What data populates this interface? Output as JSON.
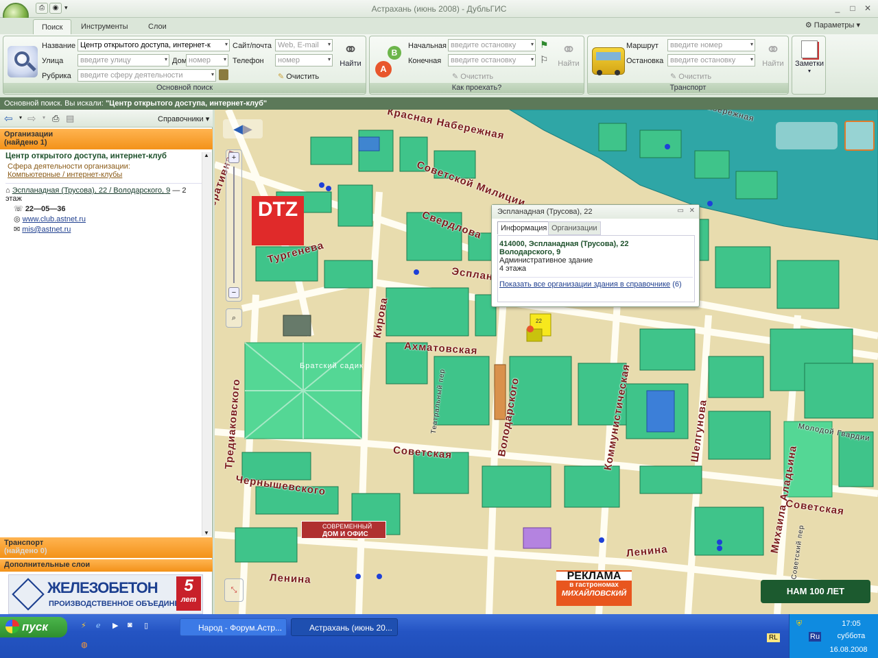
{
  "window": {
    "title": "Астрахань (июнь 2008) - ДубльГИС"
  },
  "tabs": [
    "Поиск",
    "Инструменты",
    "Слои"
  ],
  "params_label": "Параметры",
  "search": {
    "name_label": "Название",
    "name_value": "Центр открытого доступа, интернет-к",
    "street_label": "Улица",
    "street_placeholder": "введите улицу",
    "house_label": "Дом",
    "house_placeholder": "номер",
    "rubric_label": "Рубрика",
    "rubric_placeholder": "введите сферу деятельности",
    "site_label": "Сайт/почта",
    "site_placeholder": "Web, E-mail",
    "phone_label": "Телефон",
    "phone_placeholder": "номер",
    "find_label": "Найти",
    "clear_label": "Очистить",
    "group_title": "Основной поиск"
  },
  "route": {
    "start_label": "Начальная",
    "end_label": "Конечная",
    "placeholder": "введите остановку",
    "find_label": "Найти",
    "clear_label": "Очистить",
    "group_title": "Как проехать?"
  },
  "transport": {
    "route_label": "Маршрут",
    "route_placeholder": "введите номер",
    "stop_label": "Остановка",
    "stop_placeholder": "введите остановку",
    "find_label": "Найти",
    "clear_label": "Очистить",
    "group_title": "Транспорт"
  },
  "notes_label": "Заметки",
  "infobar": {
    "prefix": "Основной поиск. Вы искали:",
    "query": "\"Центр открытого доступа, интернет-клуб\""
  },
  "sidebar": {
    "directories": "Справочники",
    "orgs_header": "Организации",
    "orgs_found": "(найдено 1)",
    "org_name": "Центр открытого доступа, интернет-клуб",
    "sphere_label": "Сфера деятельности организации:",
    "sphere_link": "Компьютерные / интернет-клубы",
    "address_link": "Эспланадная (Трусова), 22 / Володарского, 9",
    "address_suffix": "— 2",
    "floor": "этаж",
    "phone": "22—05—36",
    "site": "www.club.astnet.ru",
    "email": "mis@astnet.ru",
    "transport_header": "Транспорт",
    "transport_found": "(найдено 0)",
    "layers_header": "Дополнительные слои",
    "ad_title": "ЖЕЛЕЗОБЕТОН",
    "ad_sub": "ПРОИЗВОДСТВЕННОЕ ОБЪЕДИНЕНИЕ",
    "ad_years": "5",
    "ad_years_word": "лет"
  },
  "popup": {
    "title": "Эспланадная (Трусова), 22",
    "tab_info": "Информация",
    "tab_orgs": "Организации",
    "addr1": "414000, Эспланадная (Трусова), 22",
    "addr2": "Володарского, 9",
    "type": "Административное здание",
    "floors": "4 этажа",
    "link": "Показать все организации здания в справочнике",
    "count": "(6)"
  },
  "map": {
    "streets": [
      "Красная Набережная",
      "Советской Милиции",
      "Свердлова",
      "Тургенева",
      "Эспланадная",
      "Кирова",
      "Ахматовская",
      "Театральный пер",
      "Володарского",
      "Коммунистическая",
      "Шелгунова",
      "Молодой Гвардии",
      "Советская",
      "Советская",
      "Тредиаковского",
      "Чернышевского",
      "Ленина",
      "Ленина",
      "Михаила Аладьина",
      "Советский пер",
      "Кооперативная",
      "Братский садик",
      "Набережная"
    ],
    "ad_dtz": "DTZ",
    "ad_office1": "СОВРЕМЕННЫЙ",
    "ad_office2": "ДОМ И ОФИС",
    "ad_reklama1": "РЕКЛАМА",
    "ad_reklama2": "в гастрономах",
    "ad_reklama3": "МИХАЙЛОВСКИЙ",
    "ad_100": "НАМ 100 ЛЕТ",
    "house_num": "22"
  },
  "taskbar": {
    "start": "пуск",
    "task1": "Народ - Форум.Астр...",
    "task2": "Астрахань (июнь 20...",
    "lang": "Ru",
    "lang2": "RL",
    "time": "17:05",
    "day": "суббота",
    "date": "16.08.2008"
  }
}
